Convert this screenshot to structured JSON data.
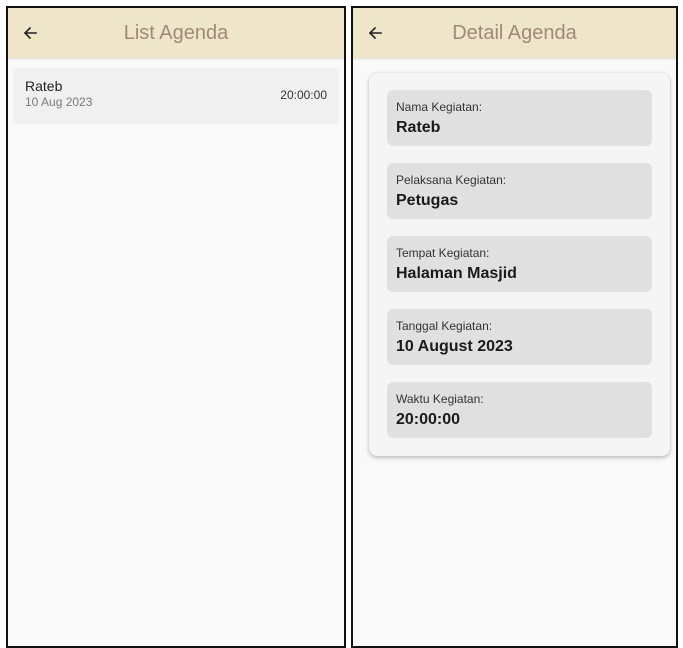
{
  "list_screen": {
    "title": "List Agenda",
    "items": [
      {
        "name": "Rateb",
        "date": "10 Aug 2023",
        "time": "20:00:00"
      }
    ]
  },
  "detail_screen": {
    "title": "Detail Agenda",
    "fields": [
      {
        "label": "Nama Kegiatan:",
        "value": "Rateb"
      },
      {
        "label": "Pelaksana Kegiatan:",
        "value": "Petugas"
      },
      {
        "label": "Tempat Kegiatan:",
        "value": "Halaman Masjid"
      },
      {
        "label": "Tanggal Kegiatan:",
        "value": "10 August 2023"
      },
      {
        "label": "Waktu Kegiatan:",
        "value": "20:00:00"
      }
    ]
  },
  "icons": {
    "back": "arrow-left-icon"
  },
  "colors": {
    "appbar_bg": "#efe5c9",
    "appbar_title": "#a08878",
    "screen_bg": "#f9f9f9",
    "list_item_bg": "#f0f0f0",
    "field_bg": "#e0e0e0"
  }
}
